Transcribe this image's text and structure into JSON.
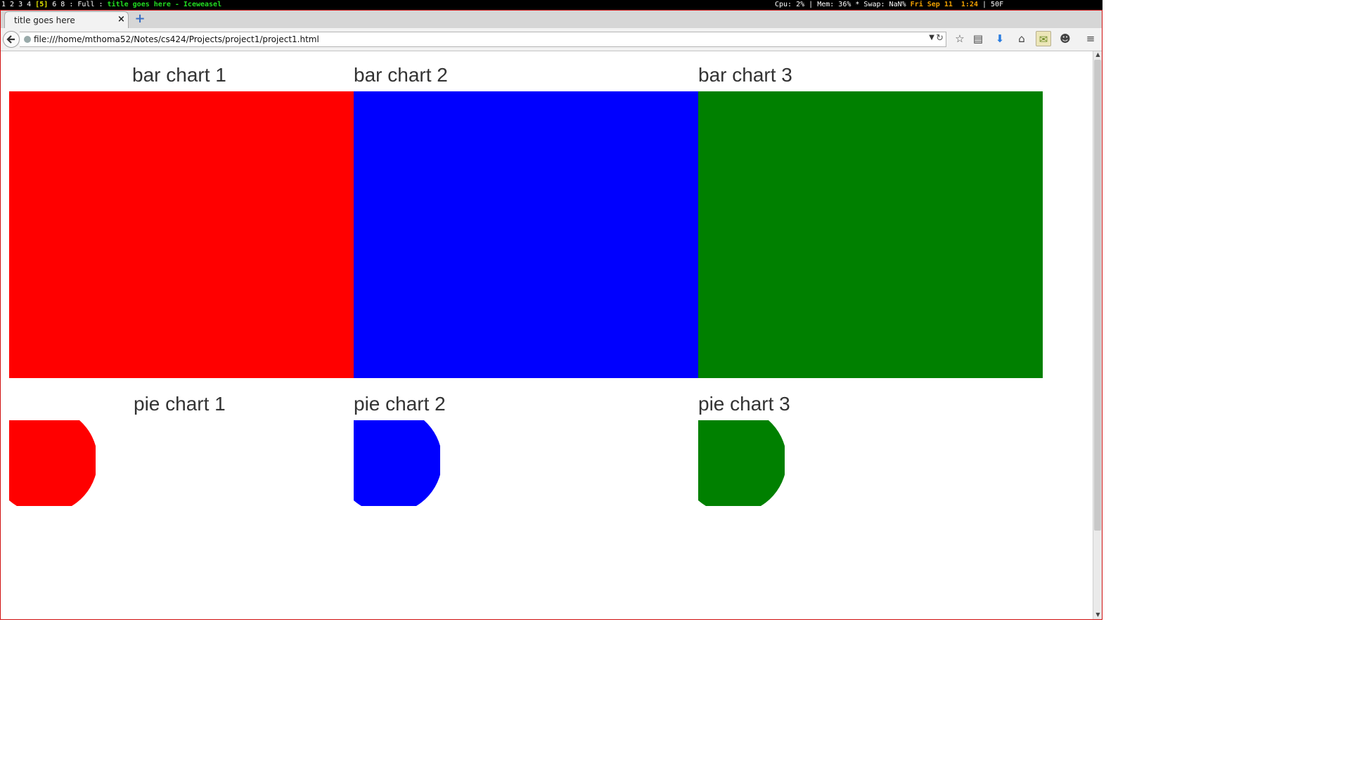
{
  "statusbar": {
    "workspaces_pre": "1 2 3 4 ",
    "workspace_active": "[5]",
    "workspaces_post": " 6 8 : Full : ",
    "window_title": "title goes here - Iceweasel",
    "system_stats": "Cpu: 2% | Mem: 36% * Swap: NaN% ",
    "datetime": "Fri Sep 11  1:24",
    "temperature": " | 50F"
  },
  "browser": {
    "tab_title": "title goes here",
    "tab_close": "×",
    "new_tab": "+",
    "url": "file:///home/mthoma52/Notes/cs424/Projects/project1/project1.html"
  },
  "icons": {
    "back": "back-arrow-icon",
    "bookmark": "star-icon",
    "reading_list": "clipboard-icon",
    "downloads": "download-arrow-icon",
    "home": "home-icon",
    "addon": "addon-icon",
    "ghost": "ghost-icon",
    "menu": "hamburger-menu-icon"
  },
  "page": {
    "bar_titles": [
      "bar chart 1",
      "bar chart 2",
      "bar chart 3"
    ],
    "pie_titles": [
      "pie chart 1",
      "pie chart 2",
      "pie chart 3"
    ]
  },
  "colors": {
    "chart1": "#ff0000",
    "chart2": "#0000ff",
    "chart3": "#008000"
  }
}
